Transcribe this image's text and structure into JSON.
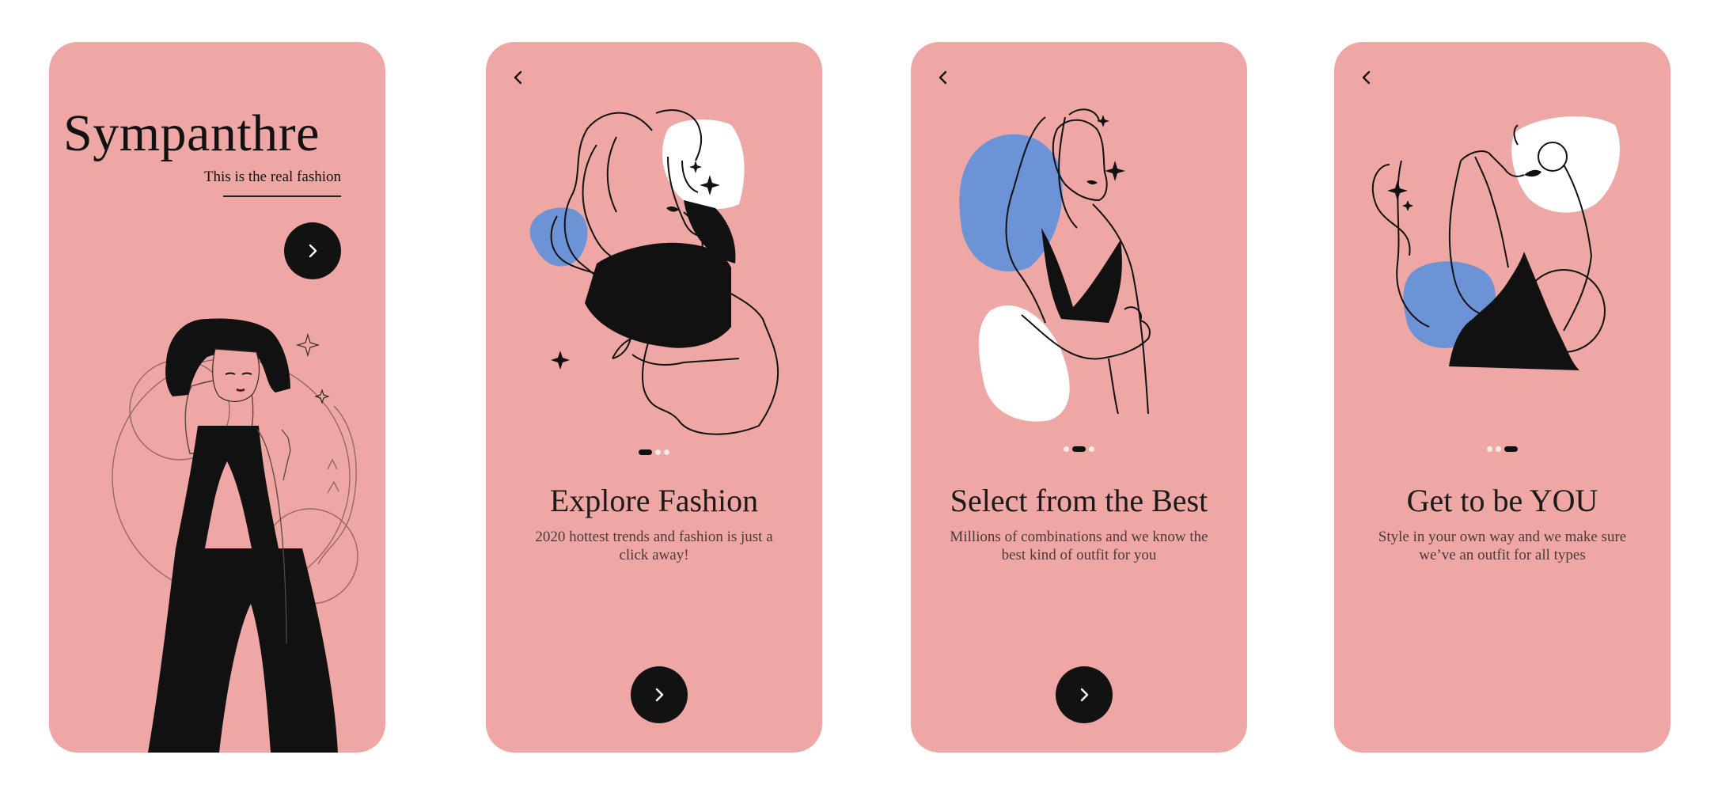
{
  "colors": {
    "card_background": "#efa7a5",
    "accent_blue": "#6b93d6",
    "button_dark": "#121212",
    "text_dark": "#1a1a1a"
  },
  "screens": [
    {
      "brand": "Sympanthre",
      "tagline": "This is the real fashion",
      "next_icon": "chevron-right-icon",
      "illustration": "woman-black-dress-illustration"
    },
    {
      "back_icon": "chevron-left-icon",
      "illustration": "woman-wavy-hair-illustration",
      "active_dot": 0,
      "title": "Explore Fashion",
      "subtitle": "2020 hottest trends and fashion is just a click away!",
      "next_icon": "chevron-right-icon"
    },
    {
      "back_icon": "chevron-left-icon",
      "illustration": "woman-profile-illustration",
      "active_dot": 1,
      "title": "Select from the Best",
      "subtitle": "Millions of combinations and we know the best kind of outfit for you",
      "next_icon": "chevron-right-icon"
    },
    {
      "back_icon": "chevron-left-icon",
      "illustration": "woman-raised-arm-illustration",
      "active_dot": 2,
      "title": "Get to be YOU",
      "subtitle": "Style in your own way and we make sure we’ve an outfit for all types"
    }
  ]
}
